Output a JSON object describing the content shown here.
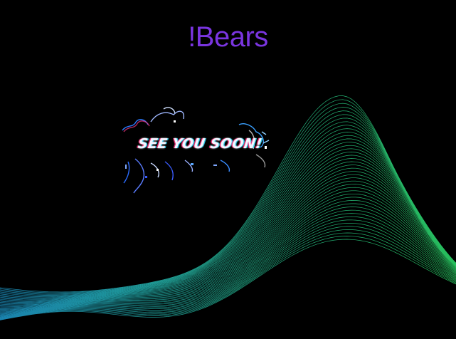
{
  "brand": {
    "title": "!Bears",
    "color": "#7a35e0"
  },
  "splash": {
    "tagline": "SEE YOU SOON!",
    "tagline_color": "#f4f6ff"
  },
  "wave": {
    "color_from": "#1f9bd1",
    "color_to": "#2ee06a"
  }
}
